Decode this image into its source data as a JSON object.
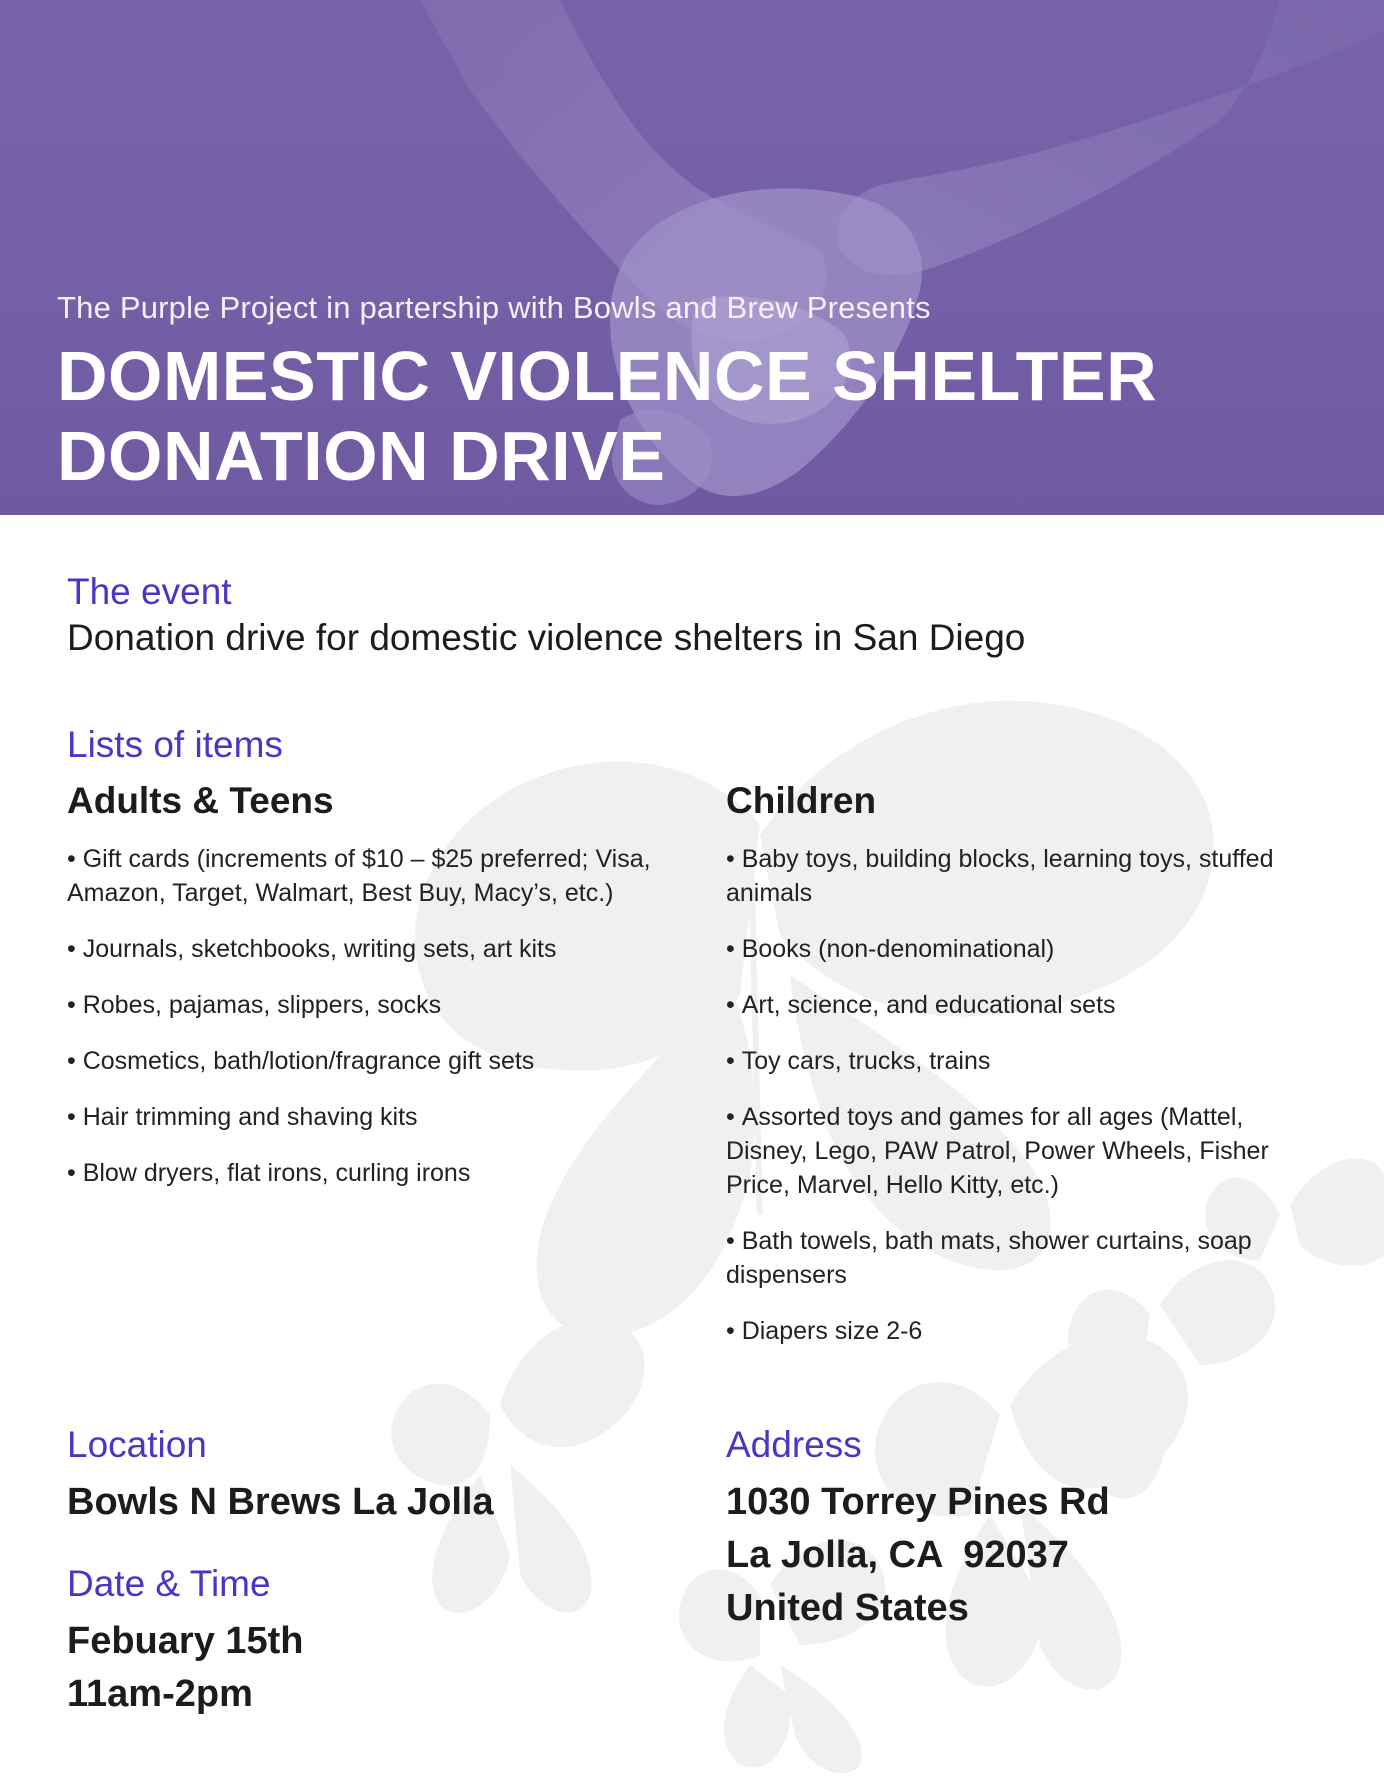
{
  "hero": {
    "presenter": "The Purple Project in partership with Bowls and Brew Presents",
    "title_line1": "DOMESTIC VIOLENCE SHELTER",
    "title_line2": "DONATION DRIVE",
    "background_color": "#7460a6"
  },
  "event": {
    "label": "The event",
    "description": "Donation drive for domestic violence shelters in San Diego"
  },
  "items": {
    "label": "Lists of items",
    "adults": {
      "heading": "Adults & Teens",
      "list": [
        "Gift cards (increments of $10 – $25 preferred; Visa, Amazon, Target, Walmart, Best Buy, Macy’s, etc.)",
        "Journals, sketchbooks, writing sets, art kits",
        "Robes, pajamas, slippers, socks",
        "Cosmetics, bath/lotion/fragrance gift sets",
        "Hair trimming and shaving kits",
        "Blow dryers, flat irons, curling irons"
      ]
    },
    "children": {
      "heading": "Children",
      "list": [
        "Baby toys, building blocks, learning toys, stuffed animals",
        "Books (non-denominational)",
        "Art, science, and educational sets",
        "Toy cars, trucks, trains",
        "Assorted toys and games for all ages (Mattel, Disney, Lego, PAW Patrol, Power Wheels, Fisher Price, Marvel, Hello Kitty, etc.)",
        "Bath towels, bath mats, shower curtains, soap dispensers",
        "Diapers size 2-6"
      ]
    }
  },
  "location": {
    "label": "Location",
    "value": "Bowls N Brews La Jolla"
  },
  "datetime": {
    "label": "Date & Time",
    "date": "Febuary 15th",
    "time": "11am-2pm"
  },
  "address": {
    "label": "Address",
    "line1": "1030 Torrey Pines Rd",
    "line2": "La Jolla, CA  92037",
    "line3": "United States"
  },
  "colors": {
    "accent": "#4a36c2",
    "hero": "#7460a6",
    "text": "#1c1c1c",
    "butterfly": "#efefef"
  }
}
